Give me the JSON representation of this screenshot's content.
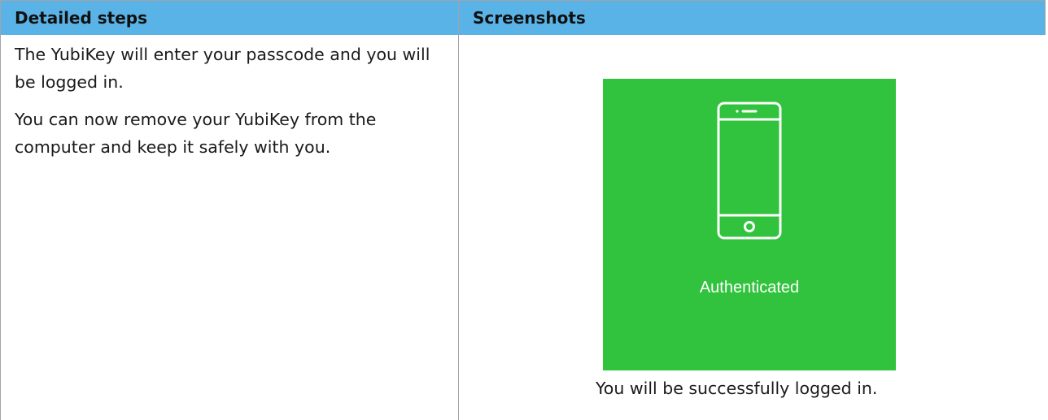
{
  "table": {
    "header": {
      "col_steps": "Detailed steps",
      "col_screenshots": "Screenshots"
    },
    "steps": {
      "paragraph_1": "The YubiKey will enter your passcode and you will be logged in.",
      "paragraph_2": "You can now remove your YubiKey from the computer and keep it safely with you."
    },
    "screenshot": {
      "status_text": "Authenticated",
      "icon": "smartphone-icon",
      "background_color": "#31c33d",
      "caption": "You will be successfully logged in."
    }
  },
  "colors": {
    "header_background": "#5ab3e6",
    "border": "#a3a3a3"
  }
}
